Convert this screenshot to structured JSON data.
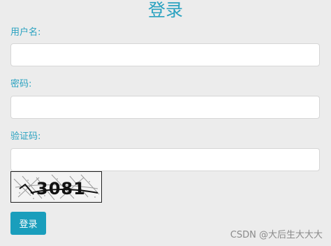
{
  "form": {
    "title": "登录",
    "username_label": "用户名:",
    "username_value": "",
    "password_label": "密码:",
    "password_value": "",
    "captcha_label": "验证码:",
    "captcha_value": "",
    "captcha_text": "3081",
    "submit_label": "登录"
  },
  "watermark": "CSDN @大后生大大大",
  "colors": {
    "accent": "#2aa2c0",
    "button": "#1a9ebc",
    "background": "#ececec"
  }
}
